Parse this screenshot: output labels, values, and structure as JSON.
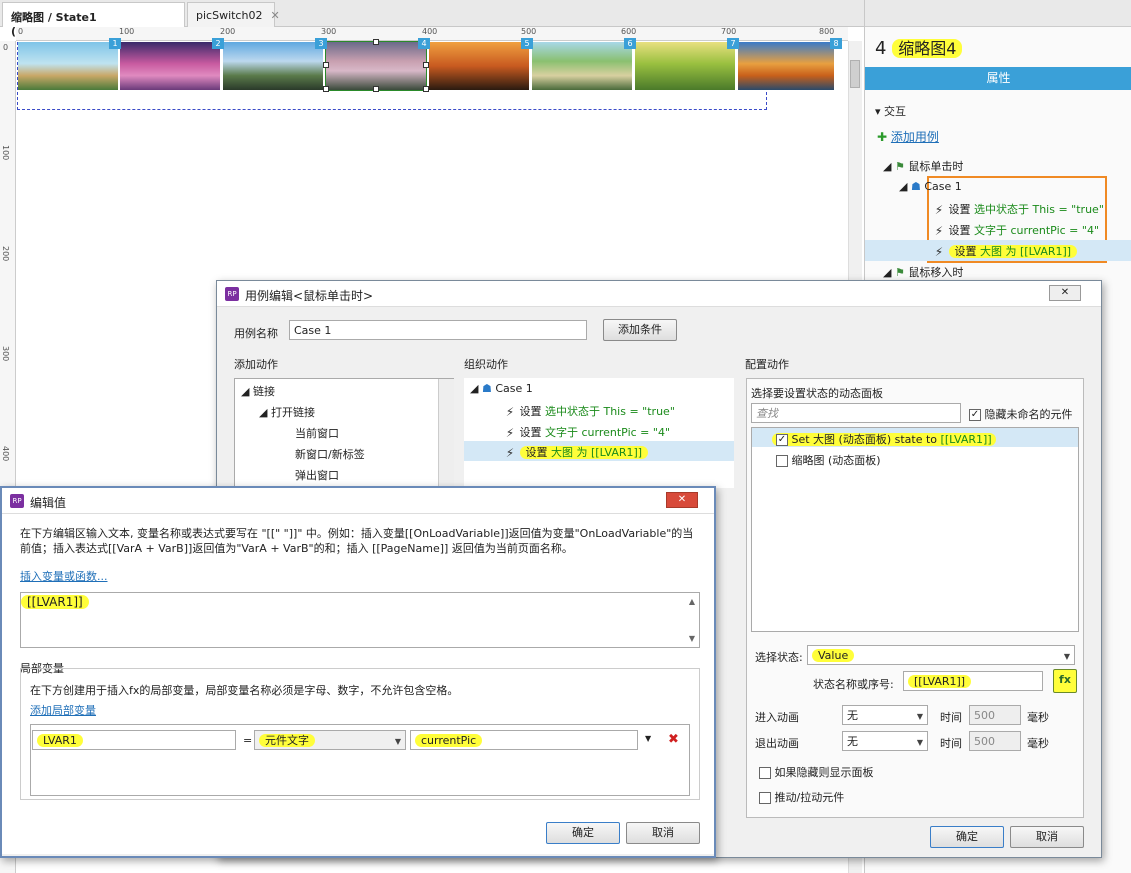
{
  "tabs": [
    {
      "label": "缩略图 / State1 (picSwitch02)",
      "close": "✕"
    },
    {
      "label": "picSwitch02",
      "close": "✕"
    }
  ],
  "ruler": {
    "h": [
      "0",
      "100",
      "200",
      "300",
      "400",
      "500",
      "600",
      "700",
      "800"
    ],
    "v": [
      "0",
      "100",
      "200",
      "300",
      "400"
    ]
  },
  "thumbs": {
    "tags": [
      "1",
      "2",
      "3",
      "4",
      "5",
      "6",
      "7",
      "8"
    ]
  },
  "rpanel": {
    "title_num": "4",
    "title": "缩略图4",
    "tab_props": "属性",
    "section": "交互",
    "add_case": "添加用例",
    "event_click": "鼠标单击时",
    "case": "Case 1",
    "actions": [
      {
        "prefix": "设置",
        "rest": "选中状态于 This = \"true\""
      },
      {
        "prefix": "设置",
        "rest": "文字于 currentPic = \"4\""
      },
      {
        "prefix": "设置",
        "rest": "大图 为 [[LVAR1]]"
      }
    ],
    "event_hover": "鼠标移入时"
  },
  "case_dialog": {
    "title": "用例编辑<鼠标单击时>",
    "name_label": "用例名称",
    "name_value": "Case 1",
    "add_condition": "添加条件",
    "col_add": "添加动作",
    "col_org": "组织动作",
    "col_cfg": "配置动作",
    "tree": [
      "链接",
      "打开链接",
      "当前窗口",
      "新窗口/新标签",
      "弹出窗口"
    ],
    "org_case": "Case 1",
    "org_actions": [
      {
        "prefix": "设置",
        "rest": "选中状态于 This = \"true\""
      },
      {
        "prefix": "设置",
        "rest": "文字于 currentPic = \"4\""
      },
      {
        "prefix": "设置",
        "rest": "大图 为 [[LVAR1]]"
      }
    ],
    "cfg_title": "选择要设置状态的动态面板",
    "search_ph": "查找",
    "hide_unnamed": "隐藏未命名的元件",
    "panels": [
      {
        "text": "Set 大图 (动态面板) state to ",
        "val": "[[LVAR1]]"
      },
      {
        "text": "缩略图 (动态面板)",
        "val": ""
      }
    ],
    "select_state_label": "选择状态:",
    "select_state_value": "Value",
    "state_name_label": "状态名称或序号:",
    "state_name_value": "[[LVAR1]]",
    "fx": "fx",
    "enter_anim": "进入动画",
    "exit_anim": "退出动画",
    "anim_none": "无",
    "time": "时间",
    "time_value": "500",
    "ms": "毫秒",
    "show_if_hidden": "如果隐藏则显示面板",
    "push_pull": "推动/拉动元件",
    "ok": "确定",
    "cancel": "取消"
  },
  "edit_dialog": {
    "title": "编辑值",
    "desc": "在下方编辑区输入文本, 变量名称或表达式要写在 \"[[\" \"]]\" 中。例如：插入变量[[OnLoadVariable]]返回值为变量\"OnLoadVariable\"的当前值；插入表达式[[VarA + VarB]]返回值为\"VarA + VarB\"的和；插入 [[PageName]] 返回值为当前页面名称。",
    "insert_link": "插入变量或函数...",
    "editor_value": "[[LVAR1]]",
    "local_section": "局部变量",
    "local_desc": "在下方创建用于插入fx的局部变量，局部变量名称必须是字母、数字，不允许包含空格。",
    "add_local": "添加局部变量",
    "var_name": "LVAR1",
    "eq": "=",
    "var_type": "元件文字",
    "var_target": "currentPic",
    "delete": "✖",
    "ok": "确定",
    "cancel": "取消"
  },
  "colors": {
    "highlight": "#fffe3a",
    "accent_blue": "#3aa0d8",
    "case_border": "#f08a24"
  }
}
